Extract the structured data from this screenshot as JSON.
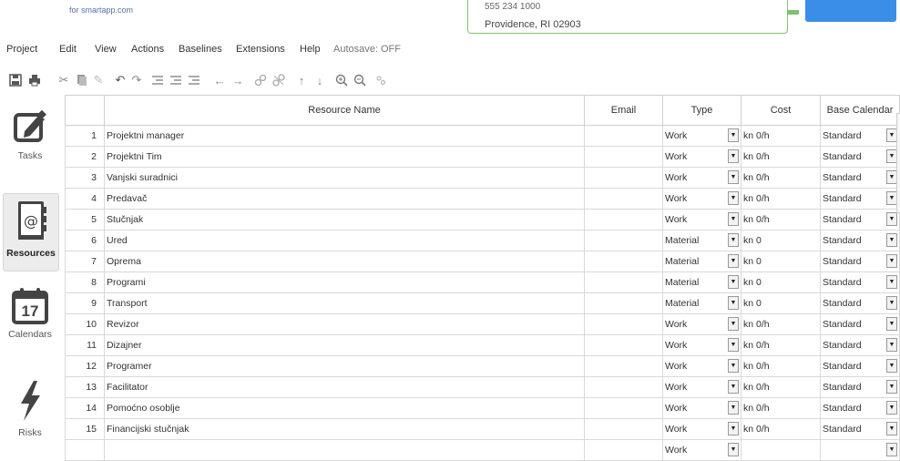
{
  "header": {
    "brand": "for smartapp.com",
    "address_line1": "555 234 1000",
    "address_line2": "Providence, RI 02903"
  },
  "menu": [
    "Project",
    "Edit",
    "View",
    "Actions",
    "Baselines",
    "Extensions",
    "Help"
  ],
  "autosave": "Autosave: OFF",
  "toolbar_icons": [
    "save-icon",
    "print-icon",
    "cut-icon",
    "copy-icon",
    "paste-icon",
    "undo-icon",
    "redo-icon",
    "indent-icon",
    "outdent-icon",
    "indent-more-icon",
    "arrow-left-icon",
    "arrow-right-icon",
    "link-icon",
    "unlink-icon",
    "arrow-up-icon",
    "arrow-down-icon",
    "zoom-in-icon",
    "zoom-out-icon",
    "settings-icon"
  ],
  "sidebar": [
    {
      "label": "Tasks",
      "icon": "edit-note-icon"
    },
    {
      "label": "Resources",
      "icon": "address-book-icon"
    },
    {
      "label": "Calendars",
      "icon": "calendar-icon",
      "day": "17"
    },
    {
      "label": "Risks",
      "icon": "lightning-icon"
    }
  ],
  "columns": {
    "name": "Resource Name",
    "email": "Email",
    "type": "Type",
    "cost": "Cost",
    "calendar": "Base Calendar"
  },
  "rows": [
    {
      "n": "1",
      "name": "Projektni manager",
      "email": "",
      "type": "Work",
      "cost": "kn 0/h",
      "calendar": "Standard"
    },
    {
      "n": "2",
      "name": "Projektni Tim",
      "email": "",
      "type": "Work",
      "cost": "kn 0/h",
      "calendar": "Standard"
    },
    {
      "n": "3",
      "name": "Vanjski suradnici",
      "email": "",
      "type": "Work",
      "cost": "kn 0/h",
      "calendar": "Standard"
    },
    {
      "n": "4",
      "name": "Predavač",
      "email": "",
      "type": "Work",
      "cost": "kn 0/h",
      "calendar": "Standard"
    },
    {
      "n": "5",
      "name": "Stučnjak",
      "email": "",
      "type": "Work",
      "cost": "kn 0/h",
      "calendar": "Standard"
    },
    {
      "n": "6",
      "name": "Ured",
      "email": "",
      "type": "Material",
      "cost": "kn 0",
      "calendar": "Standard"
    },
    {
      "n": "7",
      "name": "Oprema",
      "email": "",
      "type": "Material",
      "cost": "kn 0",
      "calendar": "Standard"
    },
    {
      "n": "8",
      "name": "Programi",
      "email": "",
      "type": "Material",
      "cost": "kn 0",
      "calendar": "Standard"
    },
    {
      "n": "9",
      "name": "Transport",
      "email": "",
      "type": "Material",
      "cost": "kn 0",
      "calendar": "Standard"
    },
    {
      "n": "10",
      "name": "Revizor",
      "email": "",
      "type": "Work",
      "cost": "kn 0/h",
      "calendar": "Standard"
    },
    {
      "n": "11",
      "name": "Dizajner",
      "email": "",
      "type": "Work",
      "cost": "kn 0/h",
      "calendar": "Standard"
    },
    {
      "n": "12",
      "name": "Programer",
      "email": "",
      "type": "Work",
      "cost": "kn 0/h",
      "calendar": "Standard"
    },
    {
      "n": "13",
      "name": "Facilitator",
      "email": "",
      "type": "Work",
      "cost": "kn 0/h",
      "calendar": "Standard"
    },
    {
      "n": "14",
      "name": "Pomoćno osoblje",
      "email": "",
      "type": "Work",
      "cost": "kn 0/h",
      "calendar": "Standard"
    },
    {
      "n": "15",
      "name": "Financijski stučnjak",
      "email": "",
      "type": "Work",
      "cost": "kn 0/h",
      "calendar": "Standard"
    },
    {
      "n": "",
      "name": "",
      "email": "",
      "type": "Work",
      "cost": "",
      "calendar": ""
    }
  ],
  "colors": {
    "accent": "#3a8ee6",
    "green": "#7cc36e"
  }
}
